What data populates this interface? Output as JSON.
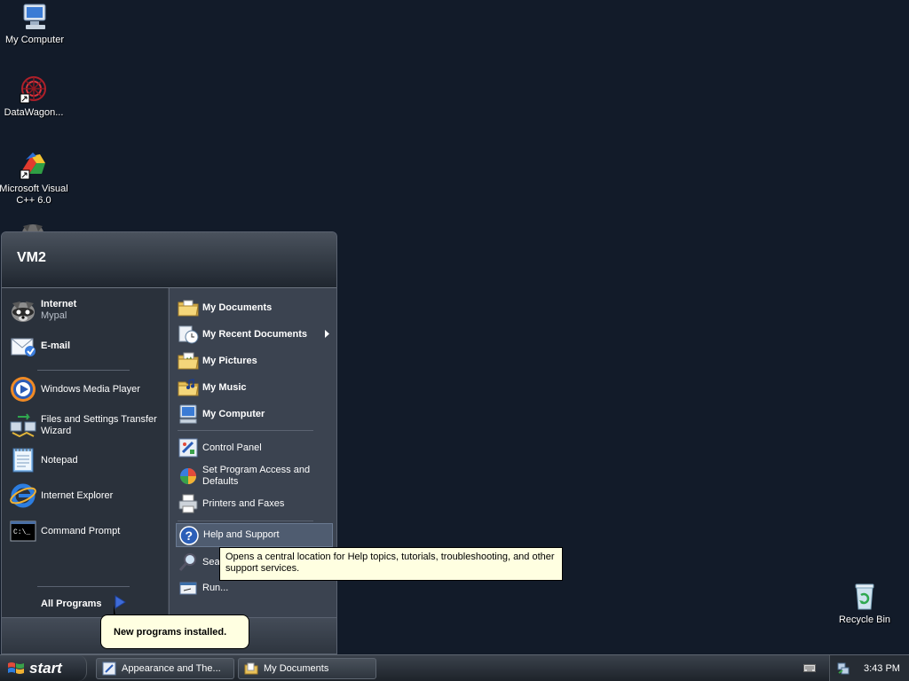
{
  "desktop": {
    "icons": [
      {
        "label": "My Computer",
        "icon": "my-computer-icon"
      },
      {
        "label": "DataWagon...",
        "icon": "datawagon-icon"
      },
      {
        "label": "Microsoft Visual C++ 6.0",
        "icon": "visual-cpp-icon"
      },
      {
        "label": "Recycle Bin",
        "icon": "recycle-bin-icon"
      }
    ]
  },
  "start_menu": {
    "user": "VM2",
    "pinned": [
      {
        "title": "Internet",
        "subtitle": "Mypal",
        "icon": "mypal-icon"
      },
      {
        "title": "E-mail",
        "icon": "email-icon"
      }
    ],
    "recent": [
      {
        "label": "Windows Media Player",
        "icon": "media-player-icon"
      },
      {
        "label": "Files and Settings Transfer Wizard",
        "icon": "transfer-wizard-icon"
      },
      {
        "label": "Notepad",
        "icon": "notepad-icon"
      },
      {
        "label": "Internet Explorer",
        "icon": "ie-icon"
      },
      {
        "label": "Command Prompt",
        "icon": "cmd-icon"
      }
    ],
    "all_programs": "All Programs",
    "places": [
      {
        "label": "My Documents",
        "icon": "folder-documents-icon"
      },
      {
        "label": "My Recent Documents",
        "icon": "recent-docs-icon"
      },
      {
        "label": "My Pictures",
        "icon": "folder-pictures-icon"
      },
      {
        "label": "My Music",
        "icon": "folder-music-icon"
      },
      {
        "label": "My Computer",
        "icon": "computer-icon"
      }
    ],
    "system": [
      {
        "label": "Control Panel",
        "icon": "control-panel-icon"
      },
      {
        "label": "Set Program Access and Defaults",
        "icon": "program-defaults-icon"
      },
      {
        "label": "Printers and Faxes",
        "icon": "printer-icon"
      }
    ],
    "help": {
      "label": "Help and Support",
      "icon": "help-icon"
    },
    "search": {
      "label": "Search",
      "visible_text": "Sear",
      "icon": "search-icon"
    },
    "run": {
      "label": "Run...",
      "icon": "run-icon"
    }
  },
  "tooltip": "Opens a central location for Help topics, tutorials, troubleshooting, and other support services.",
  "balloon": "New programs installed.",
  "taskbar": {
    "start_label": "start",
    "buttons": [
      {
        "label": "Appearance and The...",
        "icon": "control-panel-icon"
      },
      {
        "label": "My Documents",
        "icon": "folder-icon"
      }
    ],
    "clock": "3:43 PM"
  }
}
